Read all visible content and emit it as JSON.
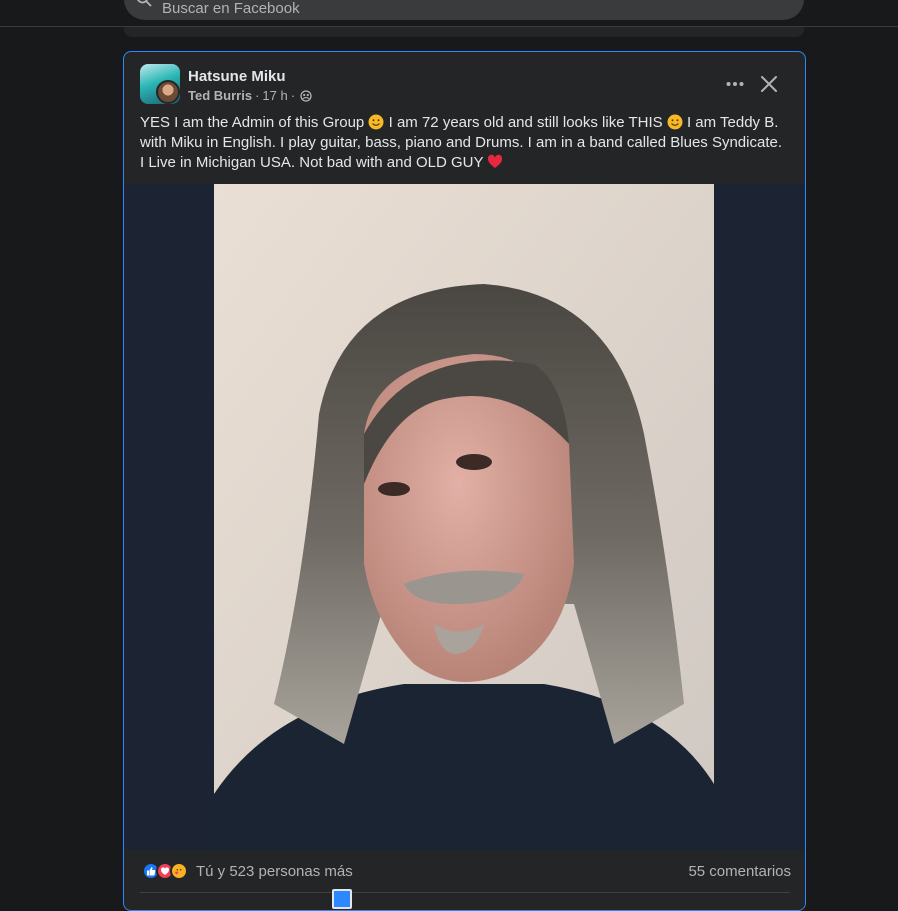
{
  "search": {
    "placeholder": "Buscar en Facebook"
  },
  "post": {
    "group_name": "Hatsune Miku",
    "author": "Ted Burris",
    "time": "17 h",
    "separator": "·",
    "text_parts": [
      "YES I am the Admin of this Group ",
      " I am 72 years old and still looks like THIS ",
      " I am Teddy B. with Miku in English. I play guitar, bass, piano and Drums. I am in a band called Blues Syndicate. I Live in Michigan USA. Not bad with and OLD GUY "
    ],
    "reactions_text": "Tú y 523 personas más",
    "comments_text": "55 comentarios",
    "reaction_icons": [
      "like-icon",
      "love-icon",
      "care-icon"
    ]
  },
  "colors": {
    "accent": "#2d88ff",
    "like": "#1877f2",
    "love": "#f33e58",
    "care": "#f7b125"
  }
}
